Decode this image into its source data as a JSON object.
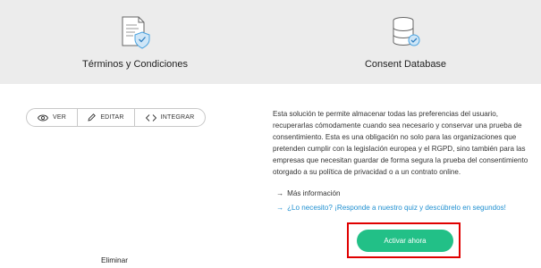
{
  "cards": {
    "terms": {
      "title": "Términos y Condiciones",
      "icon": "document-shield-icon"
    },
    "consent": {
      "title": "Consent Database",
      "icon": "database-check-icon"
    }
  },
  "toolbar": {
    "view_label": "VER",
    "edit_label": "EDITAR",
    "integrate_label": "INTEGRAR"
  },
  "description": "Esta solución te permite almacenar todas las preferencias del usuario, recuperarlas cómodamente cuando sea necesario y conservar una prueba de consentimiento. Esta es una obligación no solo para las organizaciones que pretenden cumplir con la legislación europea y el RGPD, sino también para las empresas que necesitan guardar de forma segura la prueba del consentimiento otorgado a su política de privacidad o a un contrato online.",
  "links": {
    "more_info": "Más información",
    "quiz": "¿Lo necesito? ¡Responde a nuestro quiz y descúbrelo en segundos!"
  },
  "actions": {
    "activate": "Activar ahora",
    "delete": "Eliminar"
  },
  "colors": {
    "accent_green": "#22c087",
    "link_blue": "#1f8fd0",
    "highlight_red": "#e00000",
    "icon_blue": "#4aa3e0"
  }
}
